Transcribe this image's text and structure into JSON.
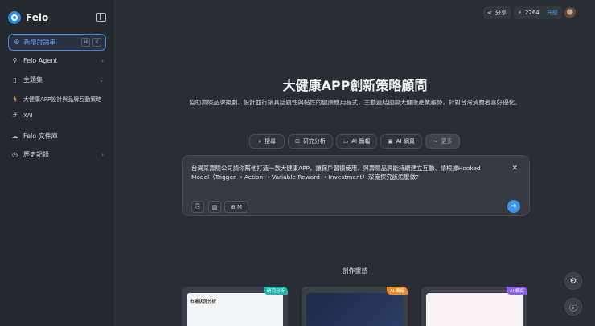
{
  "sidebar": {
    "brand": "Felo",
    "new_label": "新增討論串",
    "kbd1": "⌘",
    "kbd2": "K",
    "items": [
      {
        "label": "Felo Agent"
      },
      {
        "label": "主題集"
      },
      {
        "label": "大健康APP設計與品牌互動策略"
      },
      {
        "label": "XAI"
      },
      {
        "label": "Felo 文件庫"
      },
      {
        "label": "歷史記錄"
      }
    ]
  },
  "topbar": {
    "share_label": "分享",
    "credits": "2264",
    "upgrade_label": "升級"
  },
  "main": {
    "title": "大健康APP創新策略顧問",
    "subtitle": "協助壽險品牌規劃、設計並行銷具話題性與黏性的健康應用程式，主動連結國際大健康產業趨勢，針對台灣消費者喜好優化。",
    "tabs": [
      {
        "label": "搜尋",
        "icon": "search-icon"
      },
      {
        "label": "研究分析",
        "icon": "research-icon"
      },
      {
        "label": "AI 簡報",
        "icon": "slides-icon"
      },
      {
        "label": "AI 網頁",
        "icon": "webpage-icon"
      },
      {
        "label": "更多",
        "icon": "arrow-right-icon"
      }
    ],
    "prompt": "台灣某壽險公司請你幫他打造一款大健康APP，讓保戶習慣使用，與壽險品牌能持續建立互動、請根據Hooked Model（Trigger → Action → Variable Reward → Investment）深度探究該怎麼做?",
    "inspiration_label": "創作靈感",
    "cards": [
      {
        "badge": "研究分析",
        "badge_color": "#1fb5b0",
        "thumb_title": "市場狀況分析"
      },
      {
        "badge": "AI 簡報",
        "badge_color": "#f08a24",
        "thumb_title": ""
      },
      {
        "badge": "AI 網頁",
        "badge_color": "#8a5cf0",
        "thumb_title": ""
      }
    ]
  }
}
